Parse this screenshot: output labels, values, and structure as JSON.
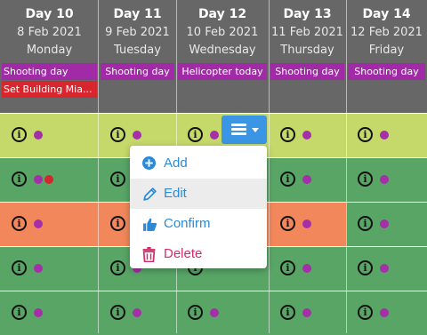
{
  "colors": {
    "header_bg": "#676767",
    "tag_purple": "#a12aa6",
    "tag_red": "#d8262e",
    "row_yellowgreen": "#c5d96a",
    "row_green": "#58a566",
    "row_orange": "#f2875b",
    "dot_purple": "#a42fa8",
    "dot_red": "#d2282b",
    "menu_button": "#3a95e4",
    "menu_text_blue": "#2b8ad8",
    "menu_text_red": "#d42b6a"
  },
  "days": [
    {
      "day": "Day 10",
      "date": "8 Feb 2021",
      "weekday": "Monday",
      "tags": [
        {
          "label": "Shooting day",
          "color": "purple"
        },
        {
          "label": "Set Building Mia...",
          "color": "red"
        }
      ]
    },
    {
      "day": "Day 11",
      "date": "9 Feb 2021",
      "weekday": "Tuesday",
      "tags": [
        {
          "label": "Shooting day",
          "color": "purple"
        }
      ]
    },
    {
      "day": "Day 12",
      "date": "10 Feb 2021",
      "weekday": "Wednesday",
      "tags": [
        {
          "label": "Helicopter today",
          "color": "purple"
        }
      ]
    },
    {
      "day": "Day 13",
      "date": "11 Feb 2021",
      "weekday": "Thursday",
      "tags": [
        {
          "label": "Shooting day",
          "color": "purple"
        }
      ]
    },
    {
      "day": "Day 14",
      "date": "12 Feb 2021",
      "weekday": "Friday",
      "tags": [
        {
          "label": "Shooting day",
          "color": "purple"
        }
      ]
    }
  ],
  "rows": [
    {
      "color": "yellowgreen",
      "cells": [
        [
          "purple"
        ],
        [
          "purple"
        ],
        [
          "purple"
        ],
        [
          "purple"
        ],
        [
          "purple"
        ]
      ]
    },
    {
      "color": "green",
      "cells": [
        [
          "purple",
          "red"
        ],
        [
          "purple"
        ],
        [],
        [
          "purple"
        ],
        [
          "purple"
        ]
      ]
    },
    {
      "color": "orange",
      "cells": [
        [
          "purple"
        ],
        [
          "purple"
        ],
        [],
        [
          "purple"
        ],
        [
          "purple"
        ]
      ],
      "orange_cols": [
        0,
        1,
        2,
        3
      ]
    },
    {
      "color": "green",
      "cells": [
        [
          "purple"
        ],
        [
          "purple"
        ],
        [],
        [
          "purple"
        ],
        [
          "purple"
        ]
      ]
    },
    {
      "color": "green",
      "cells": [
        [
          "purple"
        ],
        [
          "purple"
        ],
        [
          "purple"
        ],
        [
          "purple"
        ],
        [
          "purple"
        ]
      ]
    }
  ],
  "info_glyph": "i",
  "menu": {
    "button_icon": "bars-icon",
    "items": [
      {
        "label": "Add",
        "icon": "plus-circle-icon",
        "color": "blue",
        "hovered": false
      },
      {
        "label": "Edit",
        "icon": "pencil-icon",
        "color": "blue",
        "hovered": true
      },
      {
        "label": "Confirm",
        "icon": "thumbs-up-icon",
        "color": "blue",
        "hovered": false
      },
      {
        "label": "Delete",
        "icon": "trash-icon",
        "color": "red",
        "hovered": false
      }
    ]
  }
}
